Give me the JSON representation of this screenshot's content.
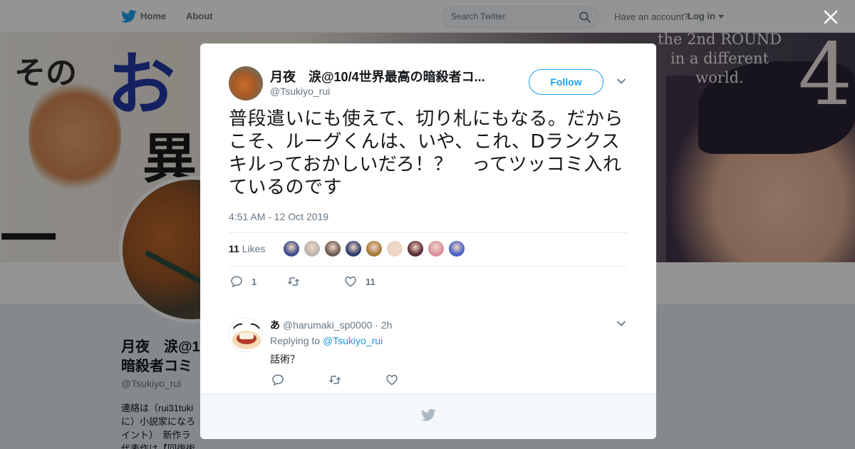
{
  "header": {
    "nav_home": "Home",
    "nav_about": "About",
    "search_placeholder": "Search Twitter",
    "have_account": "Have an account?",
    "login": "Log in"
  },
  "banner": {
    "jp_1": "その",
    "jp_2": "お",
    "jp_3": "異",
    "jp_4": "一",
    "english_lines": [
      "the 2nd ROUND",
      "in a different",
      "world."
    ],
    "volume": "4"
  },
  "profile": {
    "name_line1": "月夜　涙@1",
    "name_line2": "暗殺者コミ",
    "handle": "@Tsukiyo_rui",
    "bio_line1": "連絡は（rui31tuki",
    "bio_line2": "に）小説家になろ",
    "bio_line3": "イント）　新作ラ",
    "bio_line4": "代表作は【回復術"
  },
  "tweet": {
    "author_name": "月夜　涙@10/4世界最高の暗殺者コ...",
    "author_handle": "@Tsukiyo_rui",
    "follow_label": "Follow",
    "text": "普段遣いにも使えて、切り札にもなる。だからこそ、ルーグくんは、いや、これ、Dランクスキルっておかしいだろ！？　ってツッコミ入れているのです",
    "timestamp": "4:51 AM - 12 Oct 2019",
    "likes_count": "11",
    "likes_label": "Likes",
    "liker_colors": [
      "#3b4a8a",
      "#b9b5ad",
      "#6a5a52",
      "#2c3a6a",
      "#a67a3c",
      "#e9d6c6",
      "#5a2a36",
      "#d98fa0",
      "#4a5ec8"
    ],
    "reply_count": "1",
    "retweet_count": "",
    "like_count": "11"
  },
  "reply": {
    "author_name": "あ",
    "author_handle": "@harumaki_sp0000",
    "separator": "·",
    "time": "2h",
    "replying_prefix": "Replying to",
    "replying_to": "@Tsukiyo_rui",
    "text": "話術？"
  },
  "colors": {
    "twitter_blue": "#1da1f2",
    "link_blue": "#1b95e0",
    "secondary_text": "#657786"
  }
}
